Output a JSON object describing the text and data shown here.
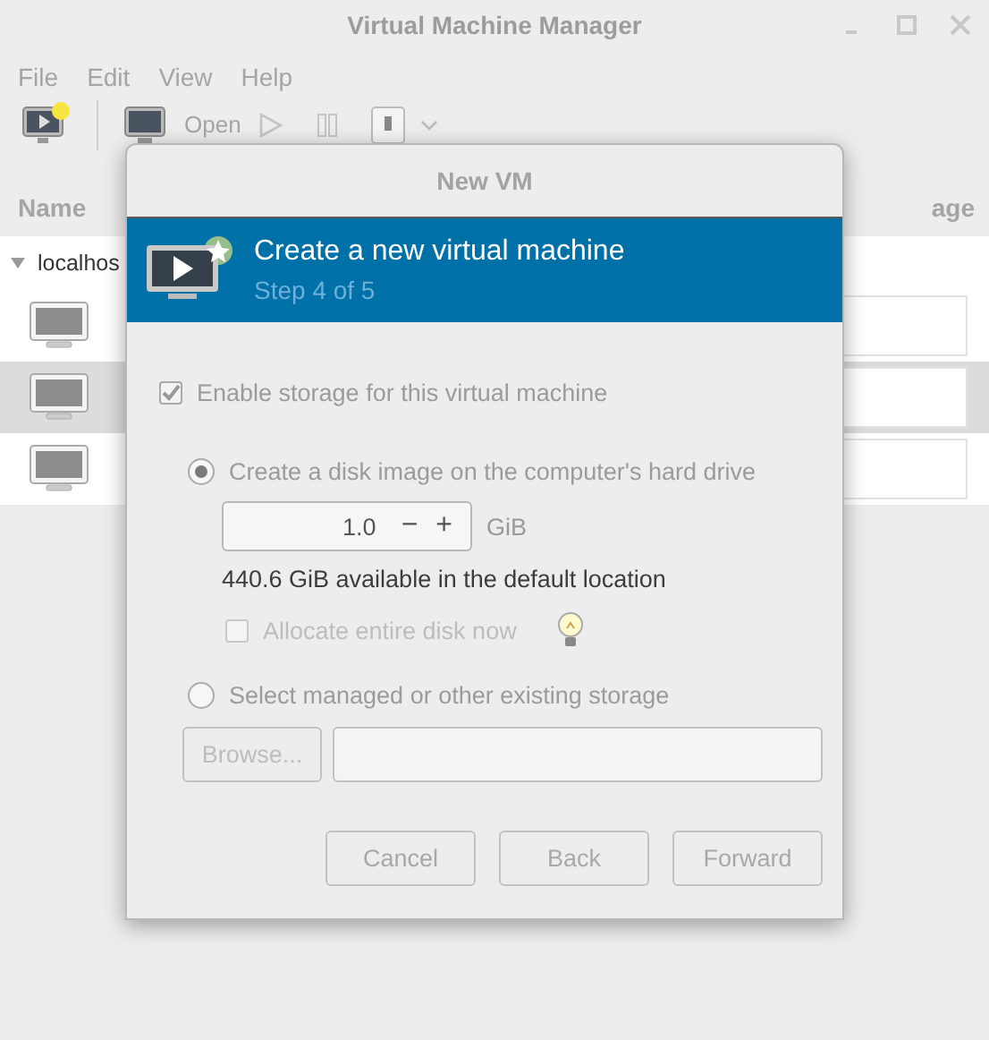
{
  "window": {
    "title": "Virtual Machine Manager"
  },
  "menu": [
    "File",
    "Edit",
    "View",
    "Help"
  ],
  "toolbar": {
    "open_label": "Open"
  },
  "list": {
    "columns": [
      "Name",
      "age"
    ],
    "host": {
      "name": "localhos",
      "expanded": true
    },
    "rows": [
      {
        "selected": false
      },
      {
        "selected": true
      },
      {
        "selected": false
      }
    ]
  },
  "dialog": {
    "title": "New VM",
    "header": {
      "title": "Create a new virtual machine",
      "subtitle": "Step 4 of 5"
    },
    "enable_storage": {
      "label": "Enable storage for this virtual machine",
      "checked": true
    },
    "options": [
      {
        "label": "Create a disk image on the computer's hard drive",
        "selected": true
      },
      {
        "label": "Select managed or other existing storage",
        "selected": false
      }
    ],
    "size": {
      "value": "1.0",
      "minus": "−",
      "plus": "+",
      "unit": "GiB"
    },
    "available": "440.6 GiB available in the default location",
    "allocate": {
      "label": "Allocate entire disk now",
      "checked": false
    },
    "browse": "Browse...",
    "buttons": [
      "Cancel",
      "Back",
      "Forward"
    ]
  }
}
